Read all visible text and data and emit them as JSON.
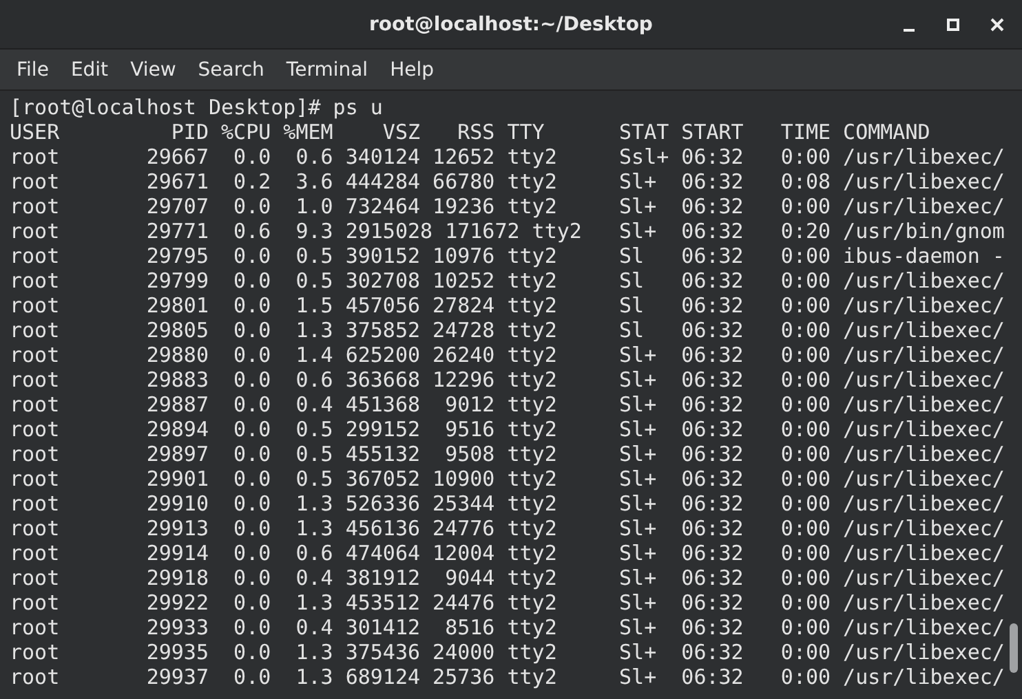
{
  "window": {
    "title": "root@localhost:~/Desktop"
  },
  "menu": [
    "File",
    "Edit",
    "View",
    "Search",
    "Terminal",
    "Help"
  ],
  "terminal": {
    "lines": [
      "[root@localhost Desktop]# ps u",
      "USER         PID %CPU %MEM    VSZ   RSS TTY      STAT START   TIME COMMAND",
      "root       29667  0.0  0.6 340124 12652 tty2     Ssl+ 06:32   0:00 /usr/libexec/",
      "root       29671  0.2  3.6 444284 66780 tty2     Sl+  06:32   0:08 /usr/libexec/",
      "root       29707  0.0  1.0 732464 19236 tty2     Sl+  06:32   0:00 /usr/libexec/",
      "root       29771  0.6  9.3 2915028 171672 tty2   Sl+  06:32   0:20 /usr/bin/gnom",
      "root       29795  0.0  0.5 390152 10976 tty2     Sl   06:32   0:00 ibus-daemon -",
      "root       29799  0.0  0.5 302708 10252 tty2     Sl   06:32   0:00 /usr/libexec/",
      "root       29801  0.0  1.5 457056 27824 tty2     Sl   06:32   0:00 /usr/libexec/",
      "root       29805  0.0  1.3 375852 24728 tty2     Sl   06:32   0:00 /usr/libexec/",
      "root       29880  0.0  1.4 625200 26240 tty2     Sl+  06:32   0:00 /usr/libexec/",
      "root       29883  0.0  0.6 363668 12296 tty2     Sl+  06:32   0:00 /usr/libexec/",
      "root       29887  0.0  0.4 451368  9012 tty2     Sl+  06:32   0:00 /usr/libexec/",
      "root       29894  0.0  0.5 299152  9516 tty2     Sl+  06:32   0:00 /usr/libexec/",
      "root       29897  0.0  0.5 455132  9508 tty2     Sl+  06:32   0:00 /usr/libexec/",
      "root       29901  0.0  0.5 367052 10900 tty2     Sl+  06:32   0:00 /usr/libexec/",
      "root       29910  0.0  1.3 526336 25344 tty2     Sl+  06:32   0:00 /usr/libexec/",
      "root       29913  0.0  1.3 456136 24776 tty2     Sl+  06:32   0:00 /usr/libexec/",
      "root       29914  0.0  0.6 474064 12004 tty2     Sl+  06:32   0:00 /usr/libexec/",
      "root       29918  0.0  0.4 381912  9044 tty2     Sl+  06:32   0:00 /usr/libexec/",
      "root       29922  0.0  1.3 453512 24476 tty2     Sl+  06:32   0:00 /usr/libexec/",
      "root       29933  0.0  0.4 301412  8516 tty2     Sl+  06:32   0:00 /usr/libexec/",
      "root       29935  0.0  1.3 375436 24000 tty2     Sl+  06:32   0:00 /usr/libexec/",
      "root       29937  0.0  1.3 689124 25736 tty2     Sl+  06:32   0:00 /usr/libexec/"
    ]
  }
}
